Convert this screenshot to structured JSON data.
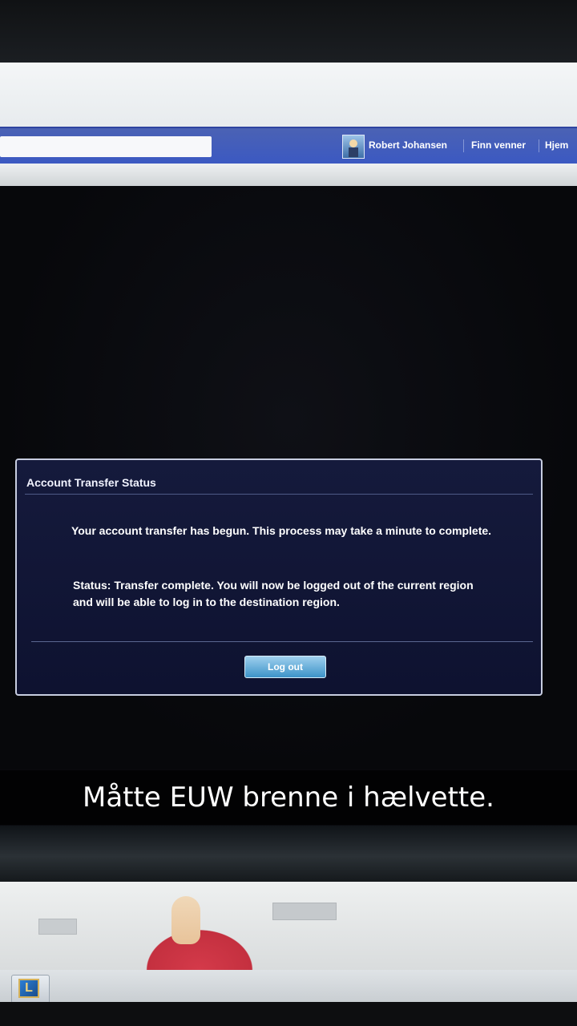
{
  "facebook_bar": {
    "user_name": "Robert Johansen",
    "link_find_friends": "Finn venner",
    "link_home": "Hjem"
  },
  "dialog": {
    "title": "Account Transfer Status",
    "message": "Your account transfer has begun. This process may take a minute to complete.",
    "status": "Status: Transfer complete. You will now be logged out of the current region and will be able to log in to the destination region.",
    "button_label": "Log out"
  },
  "caption": {
    "text": "Måtte EUW brenne i hælvette."
  },
  "taskbar": {
    "app_icon_letter": "L"
  },
  "colors": {
    "facebook_blue": "#3b59c2",
    "dialog_bg": "#151a3c",
    "button_blue": "#3d93c8"
  }
}
